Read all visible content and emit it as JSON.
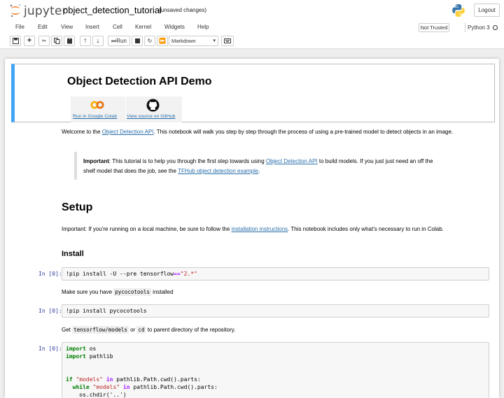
{
  "header": {
    "logo_text": "jupyter",
    "notebook_name": "object_detection_tutorial",
    "save_status": "(unsaved changes)",
    "logout_label": "Logout"
  },
  "menu": {
    "items": [
      "File",
      "Edit",
      "View",
      "Insert",
      "Cell",
      "Kernel",
      "Widgets",
      "Help"
    ],
    "trusted_label": "Not Trusted",
    "kernel_name": "Python 3"
  },
  "toolbar": {
    "run_label": "Run",
    "cell_type": "Markdown"
  },
  "cells": {
    "title": "Object Detection API Demo",
    "colab_link": "Run in Google Colab",
    "github_link": "View source on GitHub",
    "welcome": {
      "before": "Welcome to the ",
      "link": "Object Detection API",
      "after": ". This notebook will walk you step by step through the process of using a pre-trained model to detect objects in an image."
    },
    "quote": {
      "bold": "Important",
      "line1_text": ": This tutorial is to help you through the first step towards using ",
      "line1_link": "Object Detection API",
      "line1_after": " to build models. If you just just need an off the",
      "line2_before": "shelf model that does the job, see the ",
      "line2_link": "TFHub object detection example",
      "line2_after": "."
    },
    "setup_heading": "Setup",
    "setup_note": {
      "before": "Important: If you're running on a local machine, be sure to follow the ",
      "link": "installation instructions",
      "after": ". This notebook includes only what's necessary to run in Colab."
    },
    "install_heading": "Install",
    "prompt": "In [0]:",
    "code1": {
      "pre": "!pip install -U --pre tensorflow",
      "op": "==",
      "str": "\"2.*\""
    },
    "pycoco_note": {
      "before": "Make sure you have ",
      "code": "pycocotools",
      "after": " installed"
    },
    "code2": "!pip install pycocotools",
    "models_note": {
      "before": "Get ",
      "code1": "tensorflow/models",
      "mid": " or ",
      "code2": "cd",
      "after": " to parent directory of the repository."
    },
    "code3": {
      "import_kw": "import",
      "mod1": " os",
      "mod2": " pathlib",
      "if_kw": "if",
      "models_str": "\"models\"",
      "in_kw": "in",
      "cwd_expr": " pathlib.Path.cwd().parts:",
      "while_kw": "while",
      "chdir": "os.chdir('..')"
    }
  }
}
